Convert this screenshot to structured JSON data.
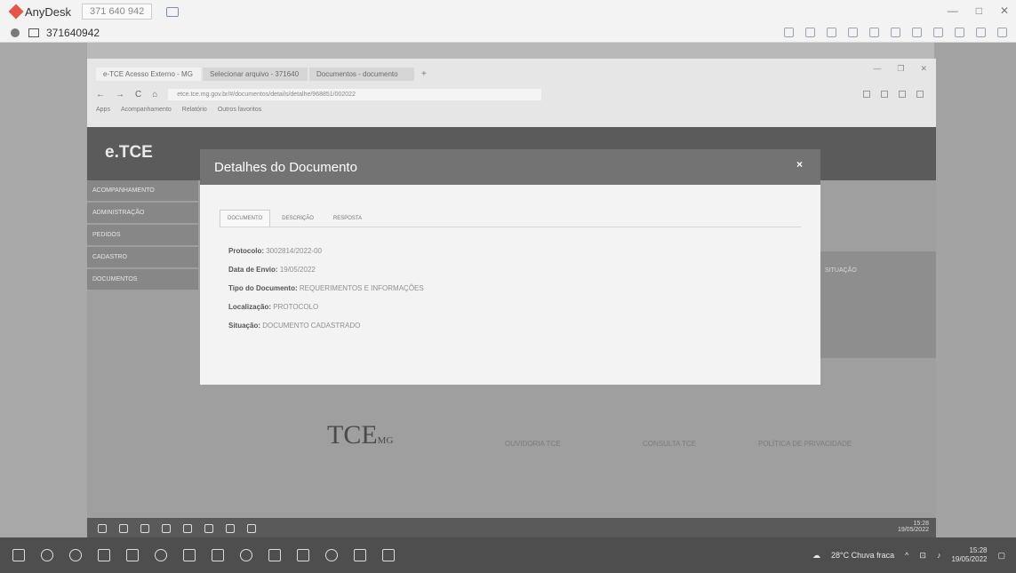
{
  "anydesk": {
    "app_name": "AnyDesk",
    "tab_label": "371 640 942",
    "address": "371640942"
  },
  "browser": {
    "tabs": [
      "e-TCE Acesso Externo - MG",
      "Selecionar arquivo - 371640",
      "Documentos - documento"
    ],
    "url": "etce.tce.mg.gov.br/#/documentos/details/detalhe/968851/002022",
    "bookmarks": [
      "Apps",
      "Acompanhamento",
      "Relatório",
      "Outros favoritos"
    ]
  },
  "site": {
    "brand": "e.TCE",
    "nav": [
      "ACOMPANHAMENTO",
      "ADMINISTRAÇÃO",
      "PEDIDOS",
      "CADASTRO",
      "DOCUMENTOS"
    ],
    "grey_text": "SITUAÇÃO",
    "footer": {
      "logo": "TCE",
      "logo_sub": "MG",
      "links": [
        "OUVIDORIA TCE",
        "CONSULTA TCE",
        "POLÍTICA DE PRIVACIDADE"
      ]
    }
  },
  "modal": {
    "title": "Detalhes do Documento",
    "close": "×",
    "tabs": [
      "DOCUMENTO",
      "DESCRIÇÃO",
      "RESPOSTA"
    ],
    "fields": [
      {
        "label": "Protocolo:",
        "value": "3002814/2022-00"
      },
      {
        "label": "Data de Envio:",
        "value": "19/05/2022"
      },
      {
        "label": "Tipo do Documento:",
        "value": "REQUERIMENTOS E INFORMAÇÕES"
      },
      {
        "label": "Localização:",
        "value": "PROTOCOLO"
      },
      {
        "label": "Situação:",
        "value": "DOCUMENTO CADASTRADO"
      }
    ]
  },
  "taskbar": {
    "weather": "28°C Chuva fraca",
    "time": "15:28",
    "date": "19/05/2022"
  },
  "remote_taskbar": {
    "time": "15:28",
    "date": "19/05/2022"
  }
}
